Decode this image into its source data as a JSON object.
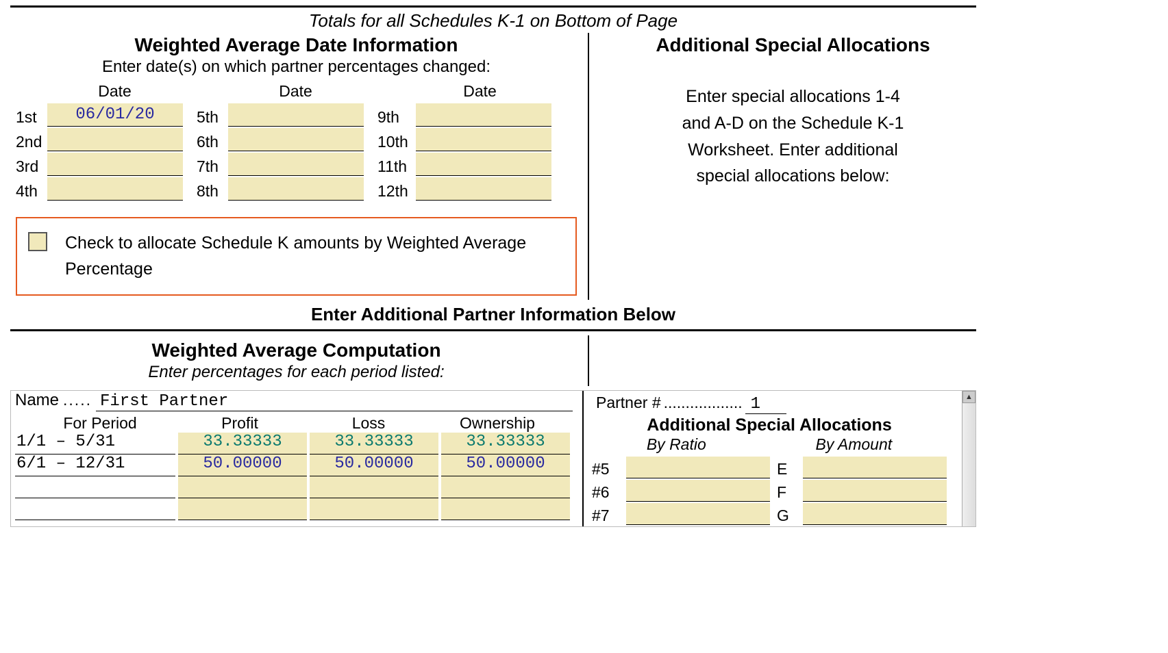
{
  "top_subtitle": "Totals for all Schedules K-1 on Bottom of Page",
  "left": {
    "heading": "Weighted Average Date Information",
    "instruction": "Enter date(s) on which partner percentages changed:",
    "date_col_header": "Date",
    "rows": [
      {
        "label": "1st",
        "value": "06/01/20"
      },
      {
        "label": "2nd",
        "value": ""
      },
      {
        "label": "3rd",
        "value": ""
      },
      {
        "label": "4th",
        "value": ""
      }
    ],
    "rows2": [
      {
        "label": "5th",
        "value": ""
      },
      {
        "label": "6th",
        "value": ""
      },
      {
        "label": "7th",
        "value": ""
      },
      {
        "label": "8th",
        "value": ""
      }
    ],
    "rows3": [
      {
        "label": "9th",
        "value": ""
      },
      {
        "label": "10th",
        "value": ""
      },
      {
        "label": "11th",
        "value": ""
      },
      {
        "label": "12th",
        "value": ""
      }
    ],
    "checkbox_text": "Check to allocate Schedule K amounts by Weighted Average Percentage"
  },
  "right": {
    "heading": "Additional Special Allocations",
    "text1": "Enter special allocations 1-4",
    "text2": "and A-D on the Schedule K-1",
    "text3": "Worksheet. Enter additional",
    "text4": "special allocations below:"
  },
  "mid_title": "Enter Additional Partner Information Below",
  "bottom": {
    "heading": "Weighted Average Computation",
    "sub": "Enter percentages for each period listed:",
    "name_label": "Name",
    "name_dots": ".....",
    "name_value": "First Partner",
    "partner_num_label": "Partner #",
    "partner_num_dots": "..................",
    "partner_num_value": "1",
    "head": {
      "period": "For Period",
      "profit": "Profit",
      "loss": "Loss",
      "ownership": "Ownership"
    },
    "rows": [
      {
        "period": "1/1 – 5/31",
        "profit": "33.33333",
        "loss": "33.33333",
        "ownership": "33.33333",
        "cls": "teal"
      },
      {
        "period": "6/1 – 12/31",
        "profit": "50.00000",
        "loss": "50.00000",
        "ownership": "50.00000",
        "cls": "blue"
      },
      {
        "period": "",
        "profit": "",
        "loss": "",
        "ownership": "",
        "cls": ""
      },
      {
        "period": "",
        "profit": "",
        "loss": "",
        "ownership": "",
        "cls": ""
      }
    ],
    "alloc": {
      "heading": "Additional Special Allocations",
      "by_ratio": "By Ratio",
      "by_amount": "By Amount",
      "rows": [
        {
          "l1": "#5",
          "l2": "E"
        },
        {
          "l1": "#6",
          "l2": "F"
        },
        {
          "l1": "#7",
          "l2": "G"
        }
      ]
    }
  }
}
